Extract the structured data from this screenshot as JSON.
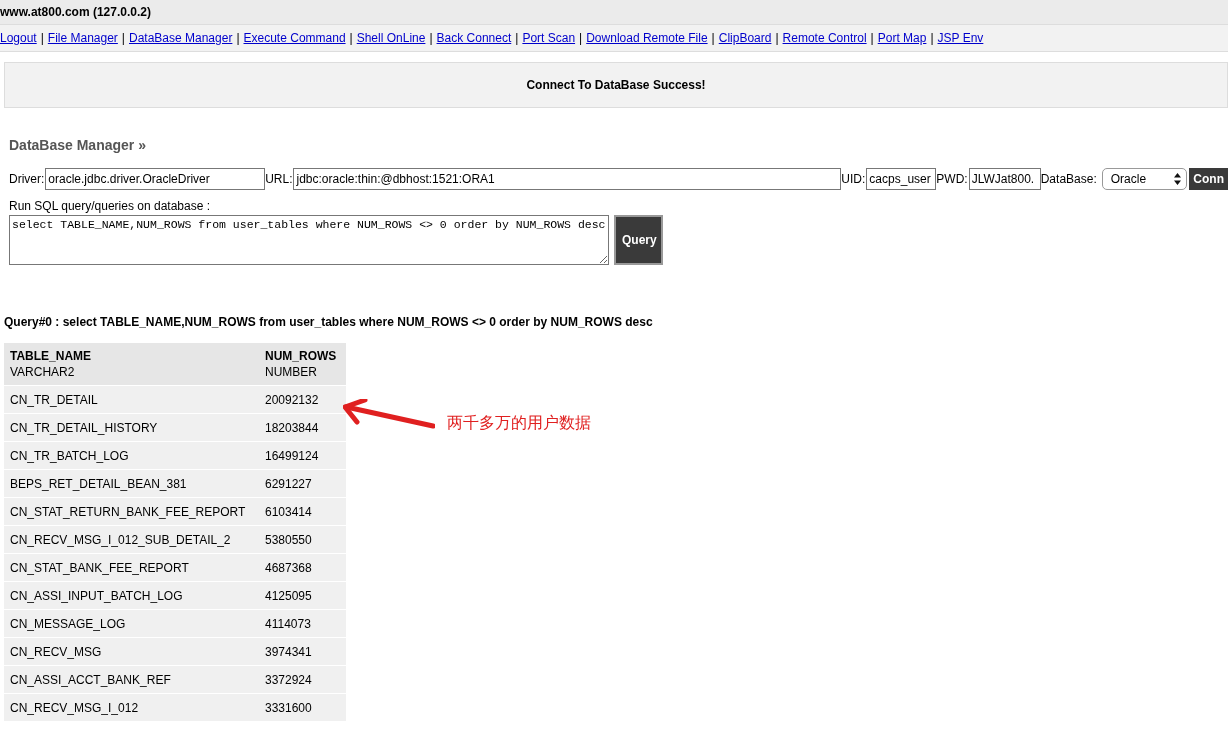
{
  "window": {
    "title": "www.at800.com (127.0.0.2)"
  },
  "nav_links": [
    "Logout",
    "File Manager",
    "DataBase Manager",
    "Execute Command",
    "Shell OnLine",
    "Back Connect",
    "Port Scan",
    "Download Remote File",
    "ClipBoard",
    "Remote Control",
    "Port Map",
    "JSP Env"
  ],
  "nav_separator": "|",
  "message": "Connect To DataBase Success!",
  "section_title": "DataBase Manager »",
  "connection": {
    "driver_label": "Driver:",
    "driver": "oracle.jdbc.driver.OracleDriver",
    "url_label": "URL:",
    "url": "jdbc:oracle:thin:@dbhost:1521:ORA1",
    "uid_label": "UID:",
    "uid": "cacps_user",
    "pwd_label": "PWD:",
    "pwd": "JLWJat800.",
    "database_label": "DataBase:",
    "database": "Oracle",
    "connect_button": "Conn"
  },
  "sql": {
    "label": "Run SQL query/queries on database :",
    "query": "select TABLE_NAME,NUM_ROWS from user_tables where NUM_ROWS <> 0 order by NUM_ROWS desc",
    "button": "Query"
  },
  "result": {
    "title": "Query#0 : select TABLE_NAME,NUM_ROWS from user_tables where NUM_ROWS <> 0 order by NUM_ROWS desc",
    "columns": [
      {
        "name": "TABLE_NAME",
        "type": "VARCHAR2"
      },
      {
        "name": "NUM_ROWS",
        "type": "NUMBER"
      }
    ],
    "rows": [
      [
        "CN_TR_DETAIL",
        "20092132"
      ],
      [
        "CN_TR_DETAIL_HISTORY",
        "18203844"
      ],
      [
        "CN_TR_BATCH_LOG",
        "16499124"
      ],
      [
        "BEPS_RET_DETAIL_BEAN_381",
        "6291227"
      ],
      [
        "CN_STAT_RETURN_BANK_FEE_REPORT",
        "6103414"
      ],
      [
        "CN_RECV_MSG_I_012_SUB_DETAIL_2",
        "5380550"
      ],
      [
        "CN_STAT_BANK_FEE_REPORT",
        "4687368"
      ],
      [
        "CN_ASSI_INPUT_BATCH_LOG",
        "4125095"
      ],
      [
        "CN_MESSAGE_LOG",
        "4114073"
      ],
      [
        "CN_RECV_MSG",
        "3974341"
      ],
      [
        "CN_ASSI_ACCT_BANK_REF",
        "3372924"
      ],
      [
        "CN_RECV_MSG_I_012",
        "3331600"
      ]
    ]
  },
  "annotation": {
    "text": "两千多万的用户数据"
  }
}
